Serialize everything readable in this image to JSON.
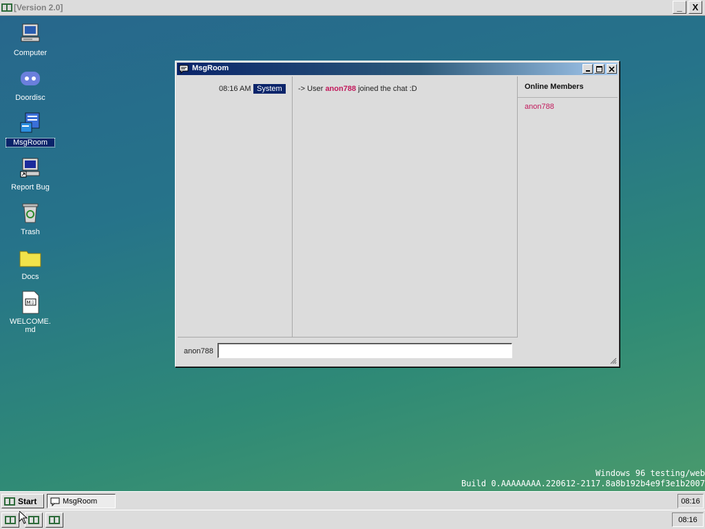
{
  "host": {
    "title": "[Version 2.0]",
    "minimize_label": "_",
    "close_label": "X"
  },
  "desktop_icons": [
    {
      "label": "Computer",
      "icon": "computer-icon"
    },
    {
      "label": "Doordisc",
      "icon": "doordisc-icon"
    },
    {
      "label": "MsgRoom",
      "icon": "msgroom-icon",
      "selected": true
    },
    {
      "label": "Report Bug",
      "icon": "report-bug-icon"
    },
    {
      "label": "Trash",
      "icon": "trash-icon"
    },
    {
      "label": "Docs",
      "icon": "folder-icon"
    },
    {
      "label": "WELCOME.md",
      "icon": "markdown-file-icon"
    }
  ],
  "window": {
    "title": "MsgRoom",
    "messages": [
      {
        "time": "08:16 AM",
        "sender": "System",
        "prefix": "-> User",
        "username": "anon788",
        "suffix": "joined the chat :D"
      }
    ],
    "members_header": "Online Members",
    "members": [
      "anon788"
    ],
    "input": {
      "username": "anon788",
      "value": "",
      "placeholder": ""
    }
  },
  "watermark": {
    "line1": "Windows 96 testing/web",
    "line2": "Build 0.AAAAAAAA.220612-2117.8a8b192b4e9f3e1b2007"
  },
  "taskbar": {
    "start_label": "Start",
    "task_label": "MsgRoom",
    "clock": "08:16"
  },
  "taskbar2": {
    "clock": "08:16"
  },
  "colors": {
    "title_active": "#0a246a",
    "username_accent": "#c2185b",
    "sender_badge": "#0a246a"
  }
}
